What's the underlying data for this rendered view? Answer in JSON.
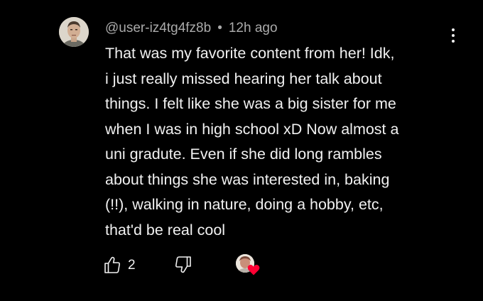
{
  "comment": {
    "username": "@user-iz4tg4fz8b",
    "separator": "•",
    "timestamp": "12h ago",
    "text": "That was my favorite content from her! Idk,\ni just really missed hearing her talk about\nthings. I felt like she was a big sister for me\nwhen I was in high school xD Now almost a\nuni gradute. Even if she did long rambles\nabout things she was interested in, baking\n(!!), walking in nature, doing a hobby, etc,\nthat'd be real cool"
  },
  "actions": {
    "like_count": "2",
    "like_icon": "thumbs-up-icon",
    "dislike_icon": "thumbs-down-icon",
    "menu_icon": "more-vertical-icon",
    "creator_heart_icon": "heart-icon"
  },
  "colors": {
    "background": "#000000",
    "text_primary": "#f1f1f1",
    "text_secondary": "#aaaaaa",
    "heart": "#ff0033"
  }
}
